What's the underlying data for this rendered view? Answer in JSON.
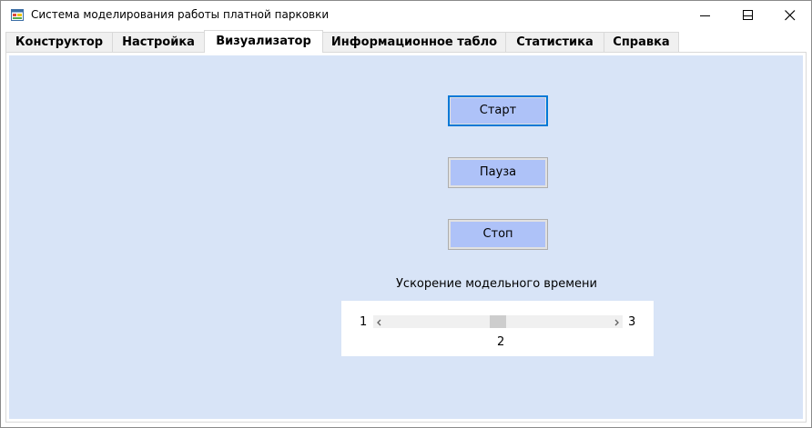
{
  "window": {
    "title": "Система моделирования работы платной парковки",
    "icon": "windows-form-icon",
    "controls": [
      "minimize-icon",
      "maximize-icon",
      "close-icon"
    ]
  },
  "tabs": [
    {
      "label": "Конструктор"
    },
    {
      "label": "Настройка"
    },
    {
      "label": "Визуализатор",
      "active": true
    },
    {
      "label": "Информационное табло"
    },
    {
      "label": "Статистика"
    },
    {
      "label": "Справка"
    }
  ],
  "visualizer": {
    "start_label": "Старт",
    "pause_label": "Пауза",
    "stop_label": "Стоп",
    "speed": {
      "title": "Ускорение модельного времени",
      "min": "1",
      "max": "3",
      "value": "2",
      "value_fraction": 0.5
    }
  },
  "colors": {
    "panel_bg": "#d8e4f7",
    "button_face": "#aec2f8",
    "focus_border": "#0078d7"
  }
}
